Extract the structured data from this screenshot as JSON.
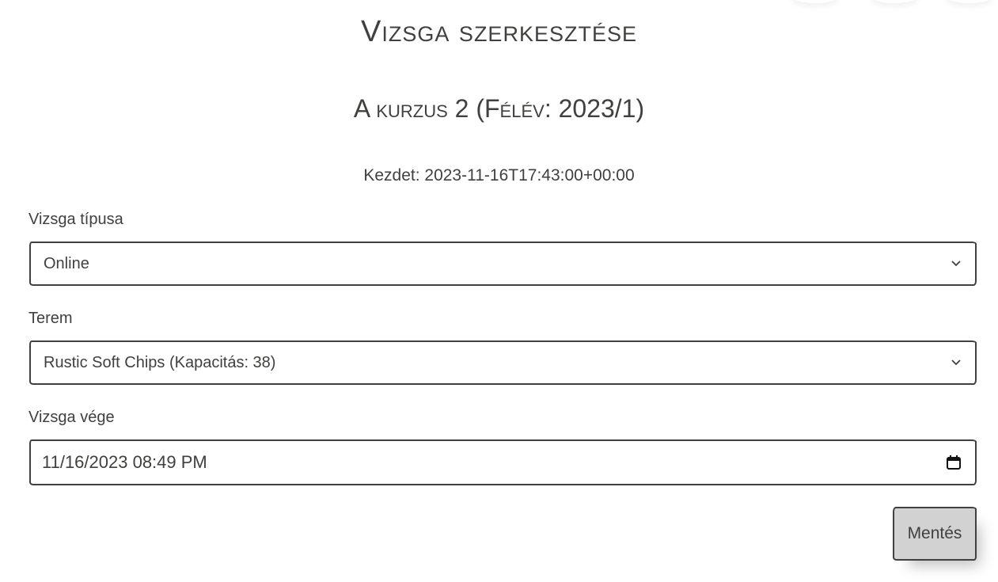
{
  "page": {
    "title": "Vizsga szerkesztése",
    "subtitle": "A kurzus 2 (Félév: 2023/1)",
    "start_text": "Kezdet: 2023-11-16T17:43:00+00:00"
  },
  "form": {
    "exam_type": {
      "label": "Vizsga típusa",
      "selected": "Online"
    },
    "room": {
      "label": "Terem",
      "selected": "Rustic Soft Chips (Kapacitás: 38)"
    },
    "exam_end": {
      "label": "Vizsga vége",
      "value": "11/16/2023 08:49 PM"
    },
    "save_label": "Mentés"
  },
  "icons": {
    "select_arrow": "chevron-down-icon",
    "date_picker": "calendar-icon"
  },
  "colors": {
    "text": "#41403e",
    "button_bg": "#d2d2d2",
    "background": "#ffffff"
  }
}
